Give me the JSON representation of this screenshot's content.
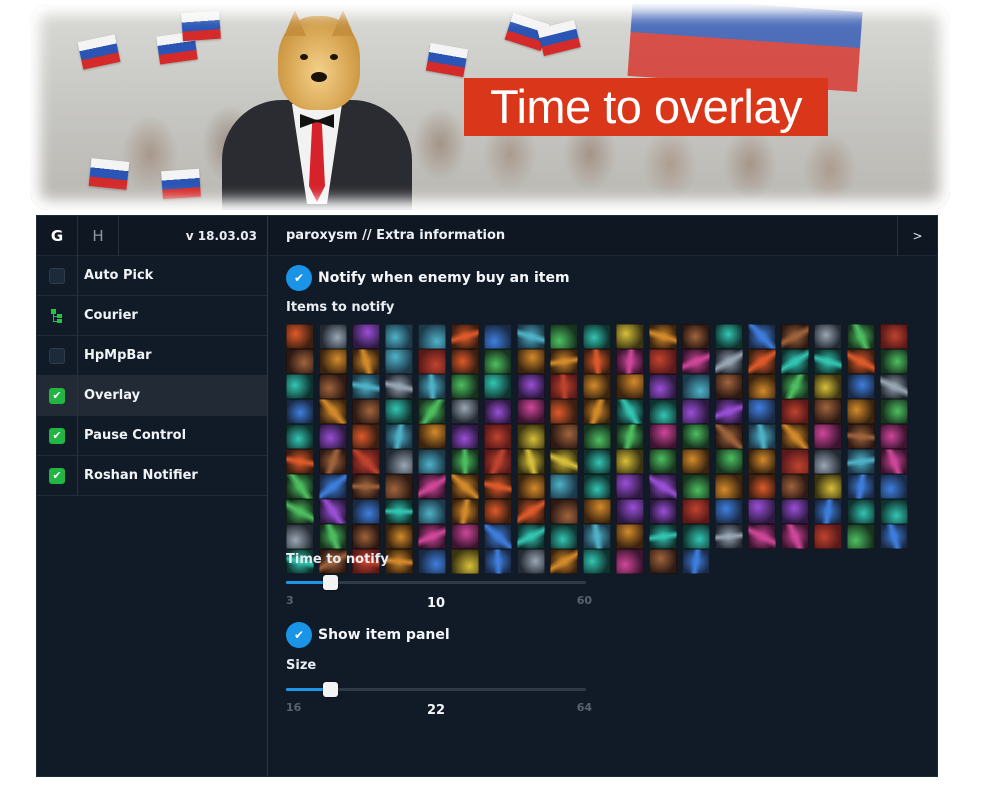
{
  "banner": {
    "title": "Time to overlay"
  },
  "sidebar": {
    "tabs": [
      {
        "label": "G",
        "active": true
      },
      {
        "label": "H",
        "active": false
      }
    ],
    "version": "v 18.03.03",
    "items": [
      {
        "label": "Auto Pick",
        "state": "unchecked"
      },
      {
        "label": "Courier",
        "state": "tree"
      },
      {
        "label": "HpMpBar",
        "state": "unchecked"
      },
      {
        "label": "Overlay",
        "state": "checked",
        "active": true
      },
      {
        "label": "Pause Control",
        "state": "checked"
      },
      {
        "label": "Roshan Notifier",
        "state": "checked"
      }
    ]
  },
  "main": {
    "title": "paroxysm // Extra information",
    "collapse_label": ">",
    "notify_toggle": {
      "label": "Notify when enemy buy an item",
      "checked": true
    },
    "items_label": "Items to notify",
    "items_count": 184,
    "time_label": "Time to notify",
    "time_slider": {
      "min": "3",
      "max": "60",
      "value": "10"
    },
    "panel_toggle": {
      "label": "Show item panel",
      "checked": true
    },
    "size_label": "Size",
    "size_slider": {
      "min": "16",
      "max": "64",
      "value": "22"
    }
  },
  "colors": {
    "accent_blue": "#1a94e6",
    "check_green": "#23b543",
    "panel_bg": "#111b28",
    "banner_red": "#d9361a"
  }
}
